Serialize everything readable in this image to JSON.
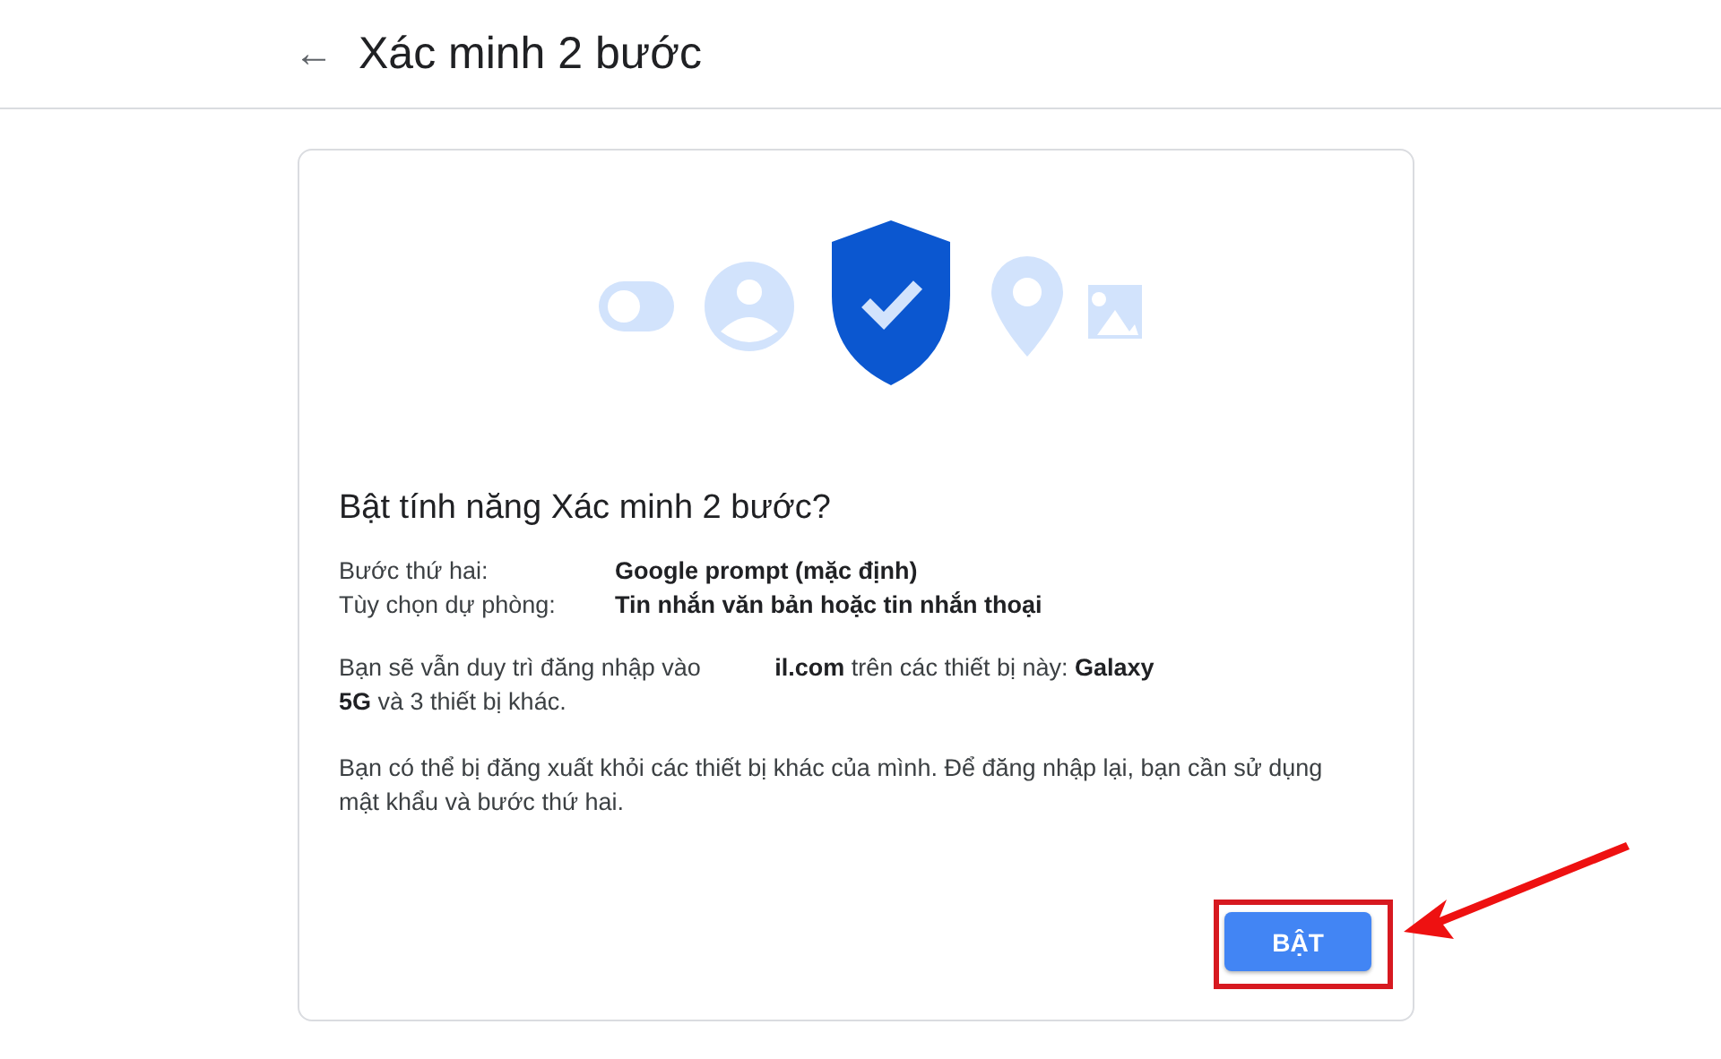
{
  "header": {
    "back_icon": "←",
    "title": "Xác minh 2 bước"
  },
  "card": {
    "heading": "Bật tính năng Xác minh 2 bước?",
    "details": [
      {
        "label": "Bước thứ hai:",
        "value": "Google prompt (mặc định)"
      },
      {
        "label": "Tùy chọn dự phòng:",
        "value": "Tin nhắn văn bản hoặc tin nhắn thoại"
      }
    ],
    "paragraphs": [
      "Bạn sẽ vẫn duy trì đăng nhập vào           **il.com** trên các thiết bị này: **Galaxy**                        **5G** và 3 thiết bị khác.",
      "Bạn có thể bị đăng xuất khỏi các thiết bị khác của mình. Để đăng nhập lại, bạn cần sử dụng mật khẩu và bước thứ hai."
    ],
    "button": "BẬT"
  }
}
